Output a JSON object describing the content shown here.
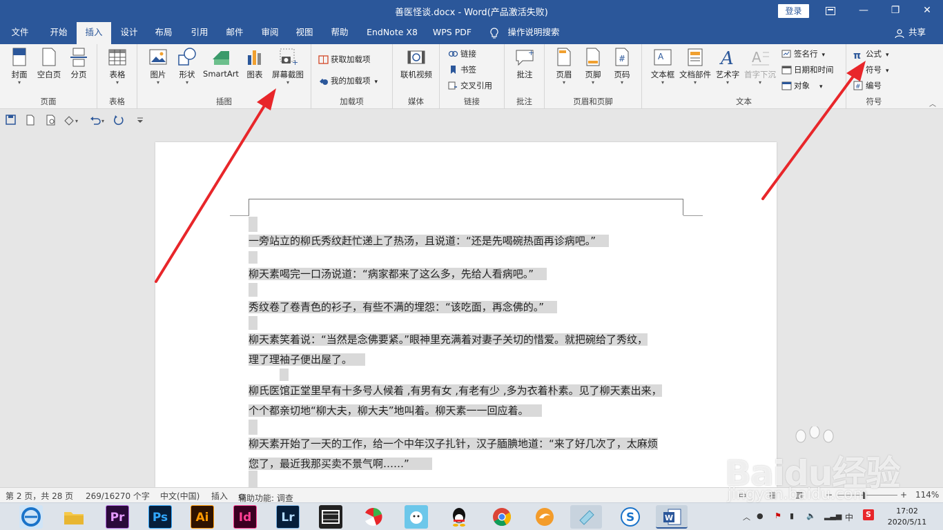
{
  "window": {
    "title": "善医怪谈.docx  -  Word(产品激活失败)",
    "login_label": "登录",
    "restore_ribbon_icon": "ribbon-display-icon",
    "minimize_label": "—",
    "maximize_label": "❐",
    "close_label": "✕"
  },
  "tabs": [
    {
      "label": "文件"
    },
    {
      "label": "开始"
    },
    {
      "label": "插入"
    },
    {
      "label": "设计"
    },
    {
      "label": "布局"
    },
    {
      "label": "引用"
    },
    {
      "label": "邮件"
    },
    {
      "label": "审阅"
    },
    {
      "label": "视图"
    },
    {
      "label": "帮助"
    },
    {
      "label": "EndNote X8"
    },
    {
      "label": "WPS PDF"
    },
    {
      "label": "操作说明搜索"
    }
  ],
  "active_tab": "插入",
  "share_label": "共享",
  "ribbon": {
    "pages": {
      "label": "页面",
      "cover": "封面",
      "blank": "空白页",
      "break": "分页"
    },
    "tables": {
      "label": "表格",
      "table": "表格"
    },
    "illustrations": {
      "label": "插图",
      "picture": "图片",
      "shapes": "形状",
      "smartart": "SmartArt",
      "chart": "图表",
      "screenshot": "屏幕截图"
    },
    "addins": {
      "label": "加载项",
      "get": "获取加载项",
      "my": "我的加载项"
    },
    "media": {
      "label": "媒体",
      "video": "联机视频"
    },
    "links": {
      "label": "链接",
      "link": "链接",
      "bookmark": "书签",
      "crossref": "交叉引用"
    },
    "comments": {
      "label": "批注",
      "comment": "批注"
    },
    "headerfooter": {
      "label": "页眉和页脚",
      "header": "页眉",
      "footer": "页脚",
      "pagenum": "页码"
    },
    "text": {
      "label": "文本",
      "textbox": "文本框",
      "parts": "文档部件",
      "wordart": "艺术字",
      "dropcap": "首字下沉",
      "signature": "签名行",
      "datetime": "日期和时间",
      "object": "对象"
    },
    "symbols": {
      "label": "符号",
      "equation": "公式",
      "symbol": "符号",
      "number": "编号"
    }
  },
  "document": {
    "paragraphs": [
      [
        "一旁站立的柳氏秀纹赶忙递上了热汤，且说道：“还是先喝碗热面再诊病吧。”"
      ],
      [
        "柳天素喝完一口汤说道：“病家都来了这么多，先给人看病吧。”"
      ],
      [
        "秀纹卷了卷青色的衫子，有些不满的埋怨：“该吃面，再念佛的。”"
      ],
      [
        "柳天素笑着说：“当然是念佛要紧。”眼神里充满着对妻子关切的惜爱。就把碗给了秀纹，",
        "理了理袖子便出屋了。"
      ],
      [
        "柳氏医馆正堂里早有十多号人候着 ,有男有女 ,有老有少 ,多为衣着朴素。见了柳天素出来，",
        "个个都亲切地“柳大夫，柳大夫”地叫着。柳天素一一回应着。"
      ],
      [
        "柳天素开始了一天的工作，给一个中年汉子扎针，汉子腼腆地道：“来了好几次了，太麻烦",
        "您了，最近我那买卖不景气啊……”"
      ]
    ]
  },
  "status": {
    "page": "第 2 页，共 28 页",
    "words": "269/16270 个字",
    "language": "中文(中国)",
    "mode": "插入",
    "accessibility": "辅助功能: 调查",
    "zoom_minus": "−",
    "zoom_plus": "+",
    "zoom": "114%"
  },
  "taskbar": {
    "apps": [
      {
        "name": "browser",
        "label": "e"
      },
      {
        "name": "explorer",
        "label": ""
      },
      {
        "name": "premiere",
        "label": "Pr"
      },
      {
        "name": "photoshop",
        "label": "Ps"
      },
      {
        "name": "illustrator",
        "label": "Ai"
      },
      {
        "name": "indesign",
        "label": "Id"
      },
      {
        "name": "lightroom",
        "label": "Lr"
      },
      {
        "name": "video-editor",
        "label": ""
      },
      {
        "name": "app-fan",
        "label": ""
      },
      {
        "name": "app-bird",
        "label": ""
      },
      {
        "name": "qq",
        "label": ""
      },
      {
        "name": "chrome",
        "label": ""
      },
      {
        "name": "app-orange",
        "label": ""
      },
      {
        "name": "app-notebook",
        "label": ""
      },
      {
        "name": "sogou",
        "label": "S"
      },
      {
        "name": "word",
        "label": "W"
      }
    ],
    "ime": "中",
    "time": "17:02",
    "date": "2020/5/11"
  },
  "watermark": {
    "brand": "Baidu经验",
    "url": "jingyan.baidu.com"
  },
  "colors": {
    "word_blue": "#2b579a",
    "arrow_red": "#e8262a",
    "highlight": "#d9d9d9"
  }
}
